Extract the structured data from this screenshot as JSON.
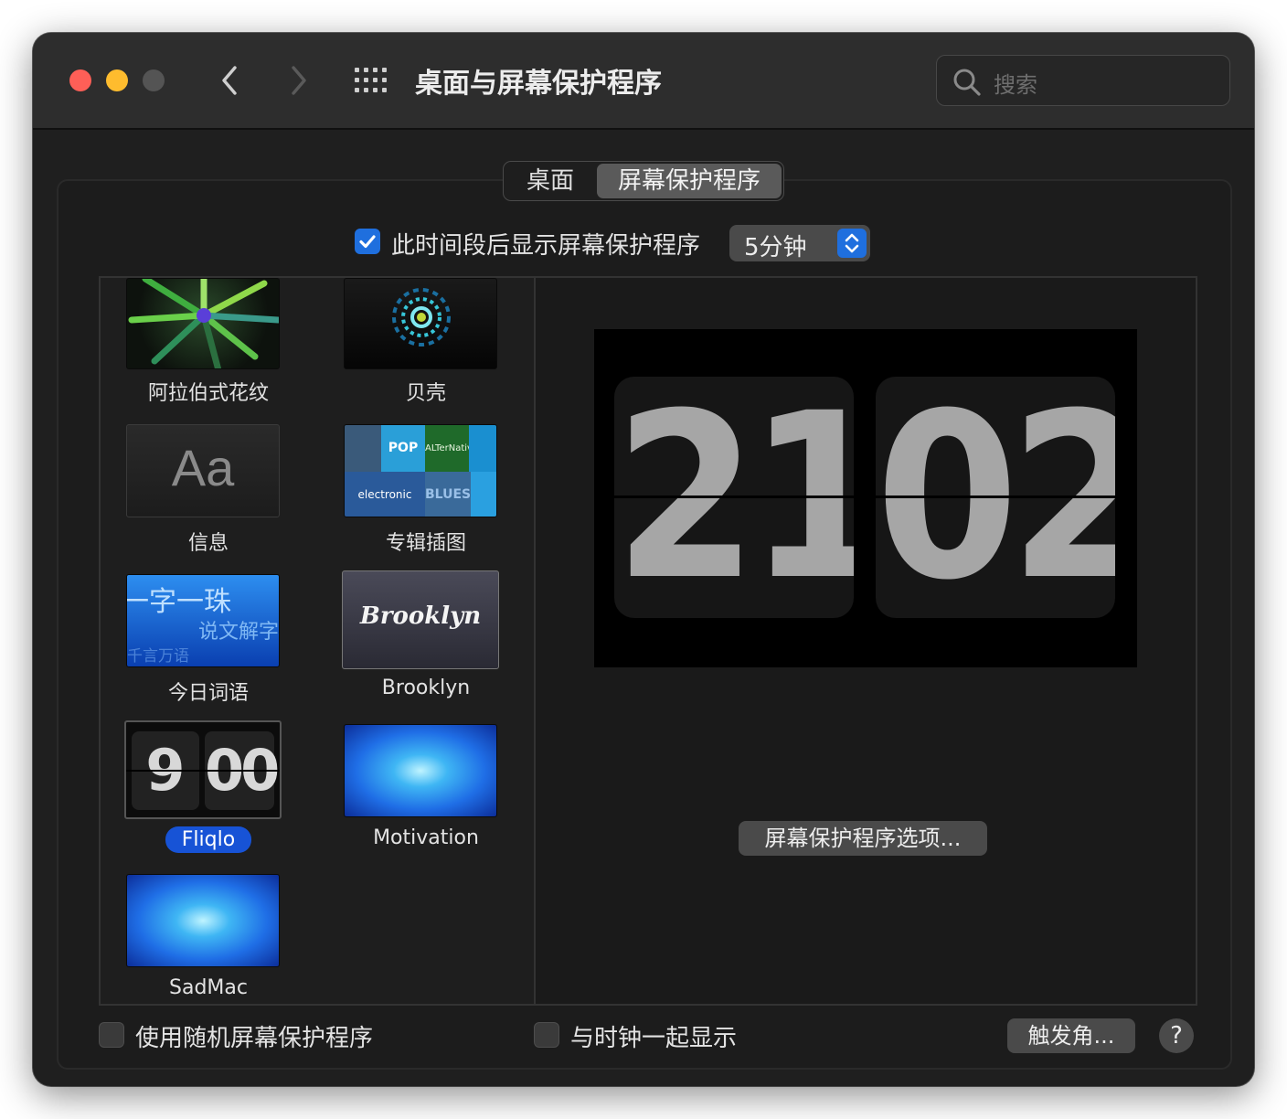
{
  "window": {
    "title": "桌面与屏幕保护程序",
    "search_placeholder": "搜索"
  },
  "tabs": [
    {
      "label": "桌面",
      "selected": false
    },
    {
      "label": "屏幕保护程序",
      "selected": true
    }
  ],
  "show_after": {
    "checked": true,
    "label": "此时间段后显示屏幕保护程序",
    "value": "5分钟"
  },
  "screensavers": [
    {
      "name": "阿拉伯式花纹",
      "icon": "arabesque-thumbnail"
    },
    {
      "name": "贝壳",
      "icon": "shell-thumbnail"
    },
    {
      "name": "信息",
      "icon": "message-thumbnail",
      "thumb_text": "Aa"
    },
    {
      "name": "专辑插图",
      "icon": "album-artwork-thumbnail",
      "thumb_words": [
        "POP",
        "ALTerNative",
        "electronic",
        "BLUES"
      ]
    },
    {
      "name": "今日词语",
      "icon": "word-of-day-thumbnail",
      "thumb_words": [
        "一字一珠",
        "说文解字",
        "千言万语"
      ]
    },
    {
      "name": "Brooklyn",
      "icon": "brooklyn-thumbnail",
      "thumb_text": "Brooklyn"
    },
    {
      "name": "Fliqlo",
      "icon": "fliqlo-thumbnail",
      "selected": true,
      "thumb_hour": "9",
      "thumb_minute": "00"
    },
    {
      "name": "Motivation",
      "icon": "motivation-thumbnail"
    },
    {
      "name": "SadMac",
      "icon": "sadmac-thumbnail"
    }
  ],
  "preview": {
    "hour": "21",
    "minute": "02",
    "options_button": "屏幕保护程序选项..."
  },
  "bottom": {
    "random_label": "使用随机屏幕保护程序",
    "random_checked": false,
    "with_clock_label": "与时钟一起显示",
    "with_clock_checked": false,
    "hot_corners_button": "触发角...",
    "help": "?"
  },
  "colors": {
    "accent": "#1f6fde",
    "selection": "#1753d6",
    "window_bg": "#1f1f1f",
    "titlebar_bg": "#2d2d2d"
  }
}
